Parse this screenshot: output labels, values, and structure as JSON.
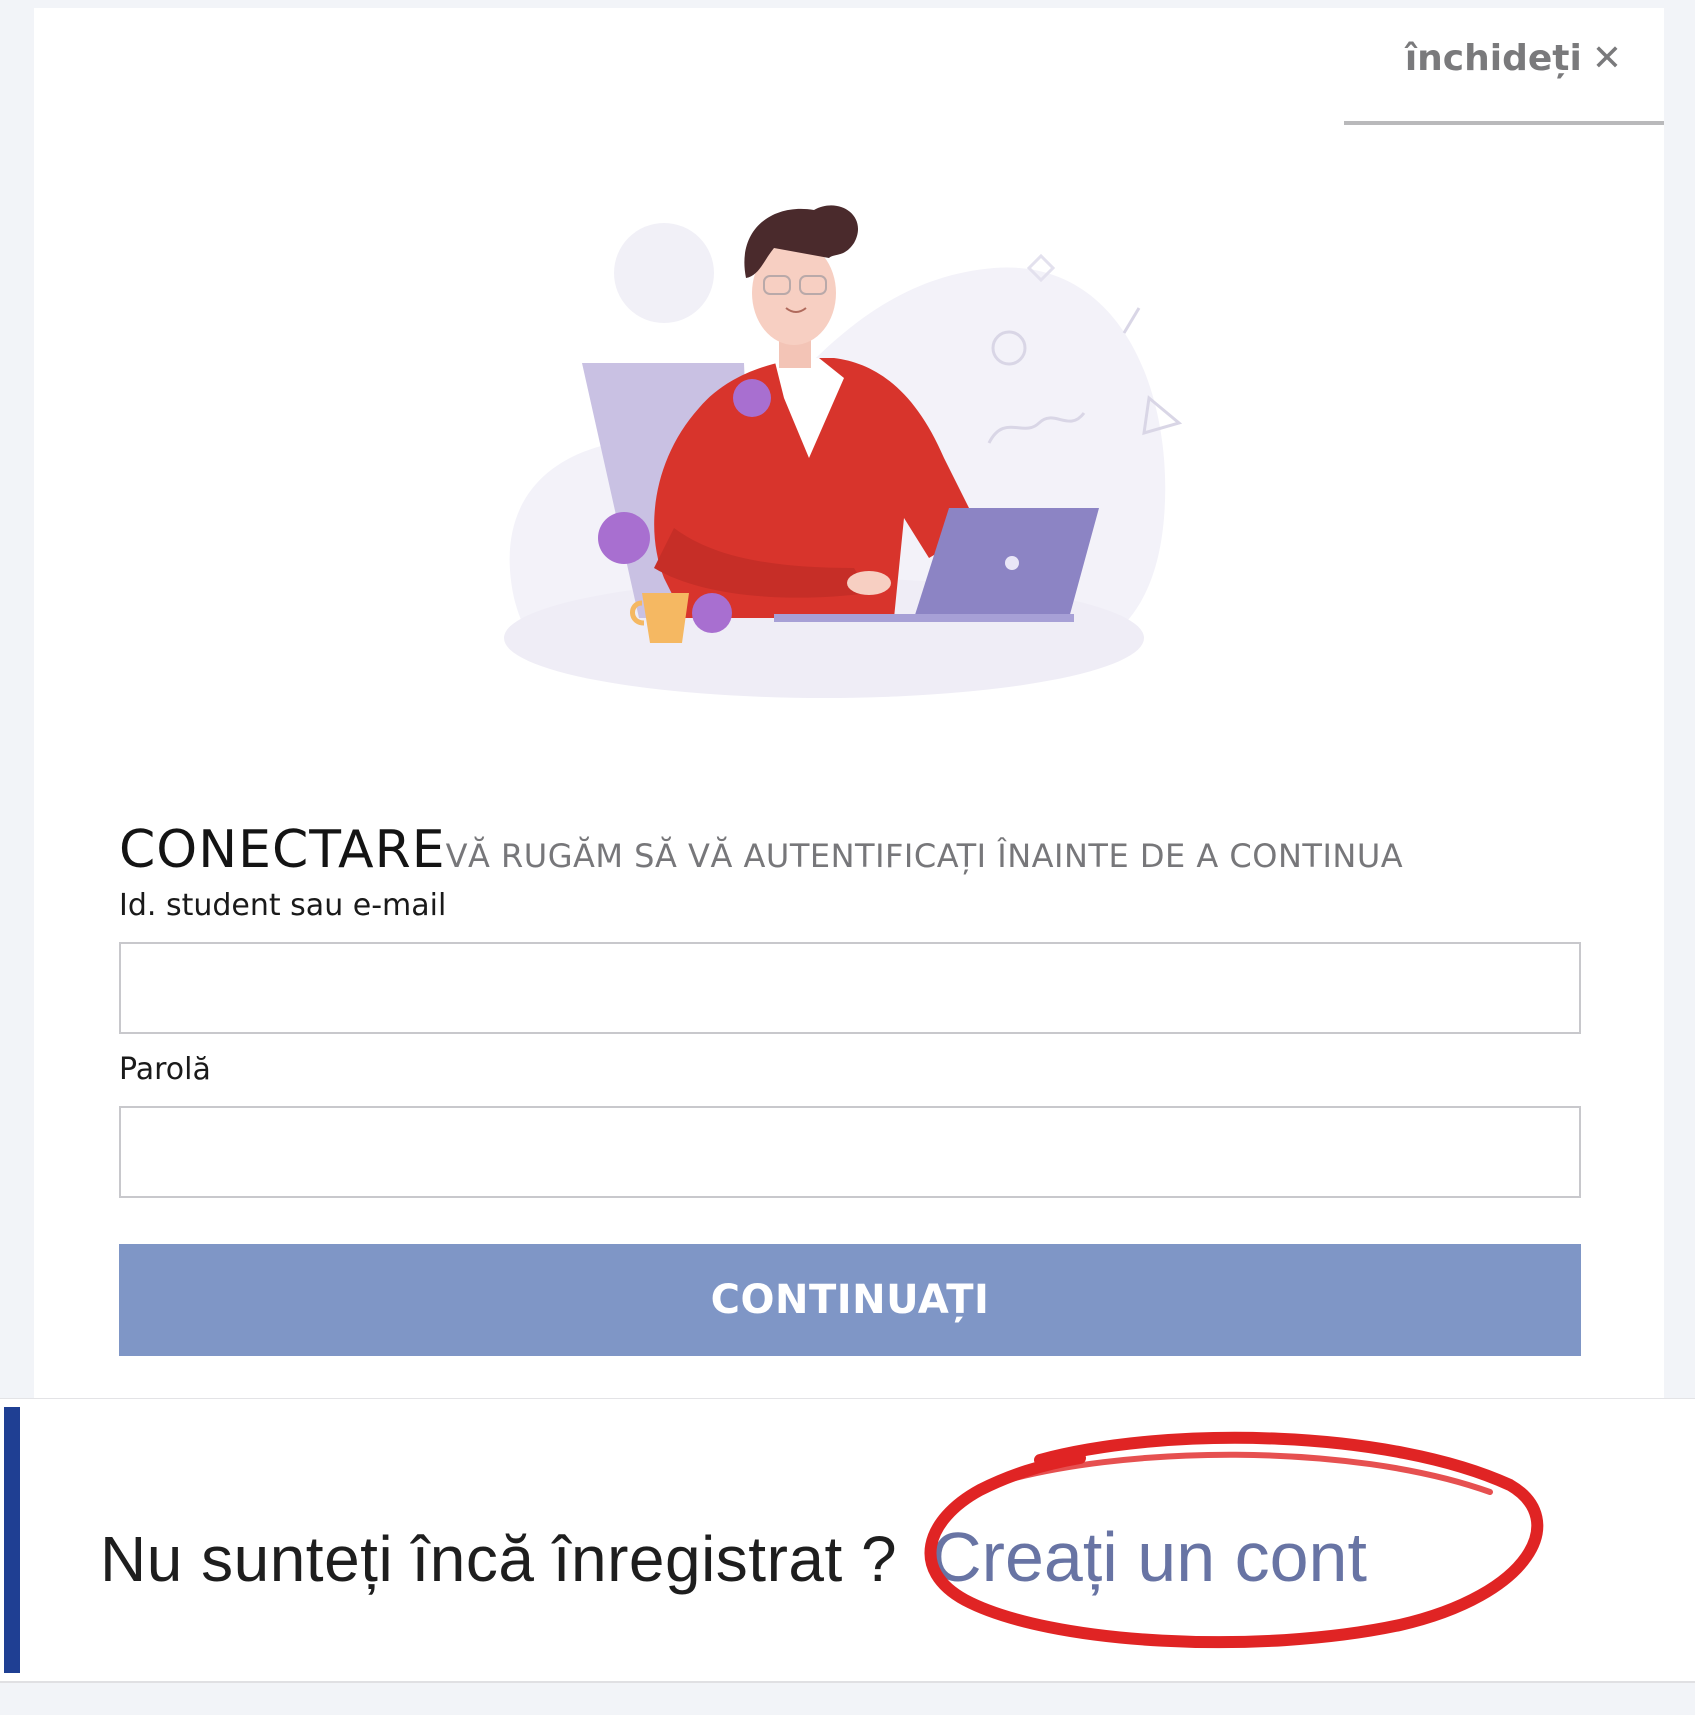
{
  "modal": {
    "close_label": "închideți",
    "close_icon": "close-icon"
  },
  "login": {
    "title": "CONECTARE",
    "subtitle": "VĂ RUGĂM SĂ VĂ AUTENTIFICAȚI ÎNAINTE DE A CONTINUA",
    "id_label": "Id. student sau e-mail",
    "id_value": "",
    "password_label": "Parolă",
    "password_value": "",
    "continue_label": "CONTINUAȚI",
    "button_color": "#7f96c6"
  },
  "register": {
    "question": "Nu sunteți încă înregistrat ?",
    "link_label": "Creați un cont",
    "highlight_color": "#e02424",
    "accent_color": "#1f3f93"
  }
}
